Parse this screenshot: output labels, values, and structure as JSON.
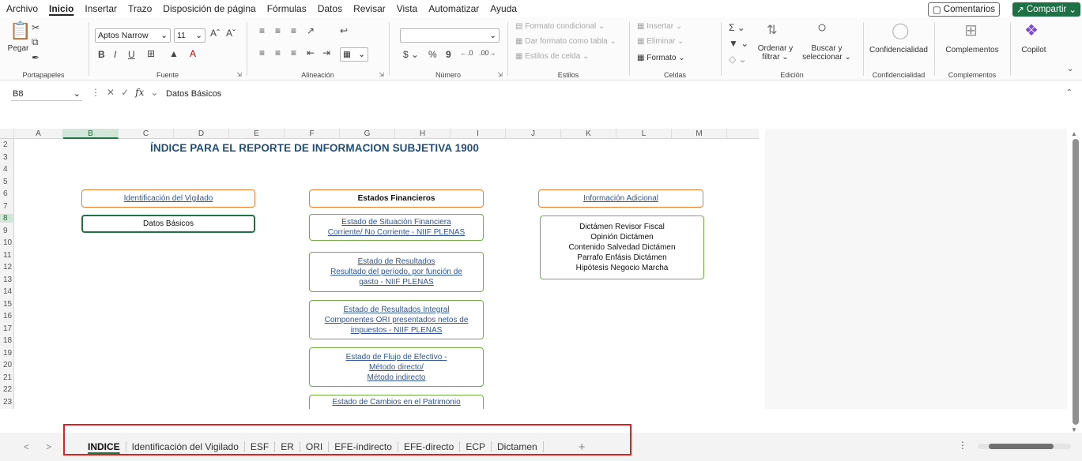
{
  "menu": {
    "tabs": [
      {
        "label": "Archivo",
        "active": false
      },
      {
        "label": "Inicio",
        "active": true
      },
      {
        "label": "Insertar",
        "active": false
      },
      {
        "label": "Trazo",
        "active": false
      },
      {
        "label": "Disposición de página",
        "active": false
      },
      {
        "label": "Fórmulas",
        "active": false
      },
      {
        "label": "Datos",
        "active": false
      },
      {
        "label": "Revisar",
        "active": false
      },
      {
        "label": "Vista",
        "active": false
      },
      {
        "label": "Automatizar",
        "active": false
      },
      {
        "label": "Ayuda",
        "active": false
      }
    ],
    "comments_label": "Comentarios",
    "share_label": "Compartir"
  },
  "ribbon": {
    "clipboard": {
      "paste": "Pegar",
      "label": "Portapapeles"
    },
    "font": {
      "name": "Aptos Narrow",
      "size": "11",
      "label": "Fuente"
    },
    "alignment": {
      "label": "Alineación"
    },
    "number": {
      "format": "",
      "currency": "$",
      "percent": "%",
      "comma": "9",
      "label": "Número"
    },
    "styles": {
      "conditional": "Formato condicional",
      "as_table": "Dar formato como tabla",
      "cell_styles": "Estilos de celda",
      "label": "Estilos"
    },
    "cells": {
      "insert": "Insertar",
      "delete": "Eliminar",
      "format": "Formato",
      "label": "Celdas"
    },
    "editing": {
      "sort_line1": "Ordenar y",
      "sort_line2": "filtrar",
      "find_line1": "Buscar y",
      "find_line2": "seleccionar",
      "label": "Edición"
    },
    "confidentiality": {
      "button": "Confidencialidad",
      "label": "Confidencialidad"
    },
    "addins": {
      "button": "Complementos",
      "label": "Complementos"
    },
    "copilot": {
      "button": "Copilot"
    }
  },
  "formula_bar": {
    "name_box": "B8",
    "value": "Datos Básicos"
  },
  "grid": {
    "columns": [
      "A",
      "B",
      "C",
      "D",
      "E",
      "F",
      "G",
      "H",
      "I",
      "J",
      "K",
      "L",
      "M"
    ],
    "selected_column": "B",
    "rows": [
      "2",
      "3",
      "4",
      "5",
      "6",
      "7",
      "8",
      "9",
      "10",
      "11",
      "12",
      "13",
      "14",
      "15",
      "16",
      "17",
      "18",
      "19",
      "20",
      "21",
      "22",
      "23"
    ],
    "selected_row": "8"
  },
  "sheet": {
    "title": "ÍNDICE PARA EL REPORTE DE INFORMACION SUBJETIVA 1900",
    "col1_header": "Identificación del Vigilado",
    "col1_items": [
      "Datos Básicos"
    ],
    "col2_header": "Estados Financieros",
    "col2_items": [
      [
        "Estado de Situación Financiera",
        "Corriente/ No Corriente - NIIF PLENAS"
      ],
      [
        "Estado de Resultados",
        "Resultado del período, por función de",
        "gasto - NIIF PLENAS"
      ],
      [
        "Estado de Resultados Integral",
        "Componentes ORI presentados netos de",
        "impuestos - NIIF PLENAS"
      ],
      [
        "Estado de Flujo de Efectivo -",
        "Método directo/",
        "Método indirecto"
      ],
      [
        "Estado de Cambios en el Patrimonio"
      ]
    ],
    "col3_header": "Información Adicional",
    "col3_items": [
      "Dictámen Revisor Fiscal",
      "Opinión Dictámen",
      "Contenido Salvedad Dictámen",
      "Parrafo Enfásis Dictámen",
      "Hipótesis Negocio Marcha"
    ]
  },
  "sheet_tabs": {
    "tabs": [
      "INDICE",
      "Identificación del Vigilado",
      "ESF",
      "ER",
      "ORI",
      "EFE-indirecto",
      "EFE-directo",
      "ECP",
      "Dictamen"
    ],
    "active": "INDICE"
  },
  "colors": {
    "accent_green": "#217346",
    "orange_border": "#ed7d31",
    "green_border": "#70ad47",
    "title_blue": "#1f4e79",
    "link_blue": "#2f5597",
    "highlight_red": "#e02020"
  }
}
